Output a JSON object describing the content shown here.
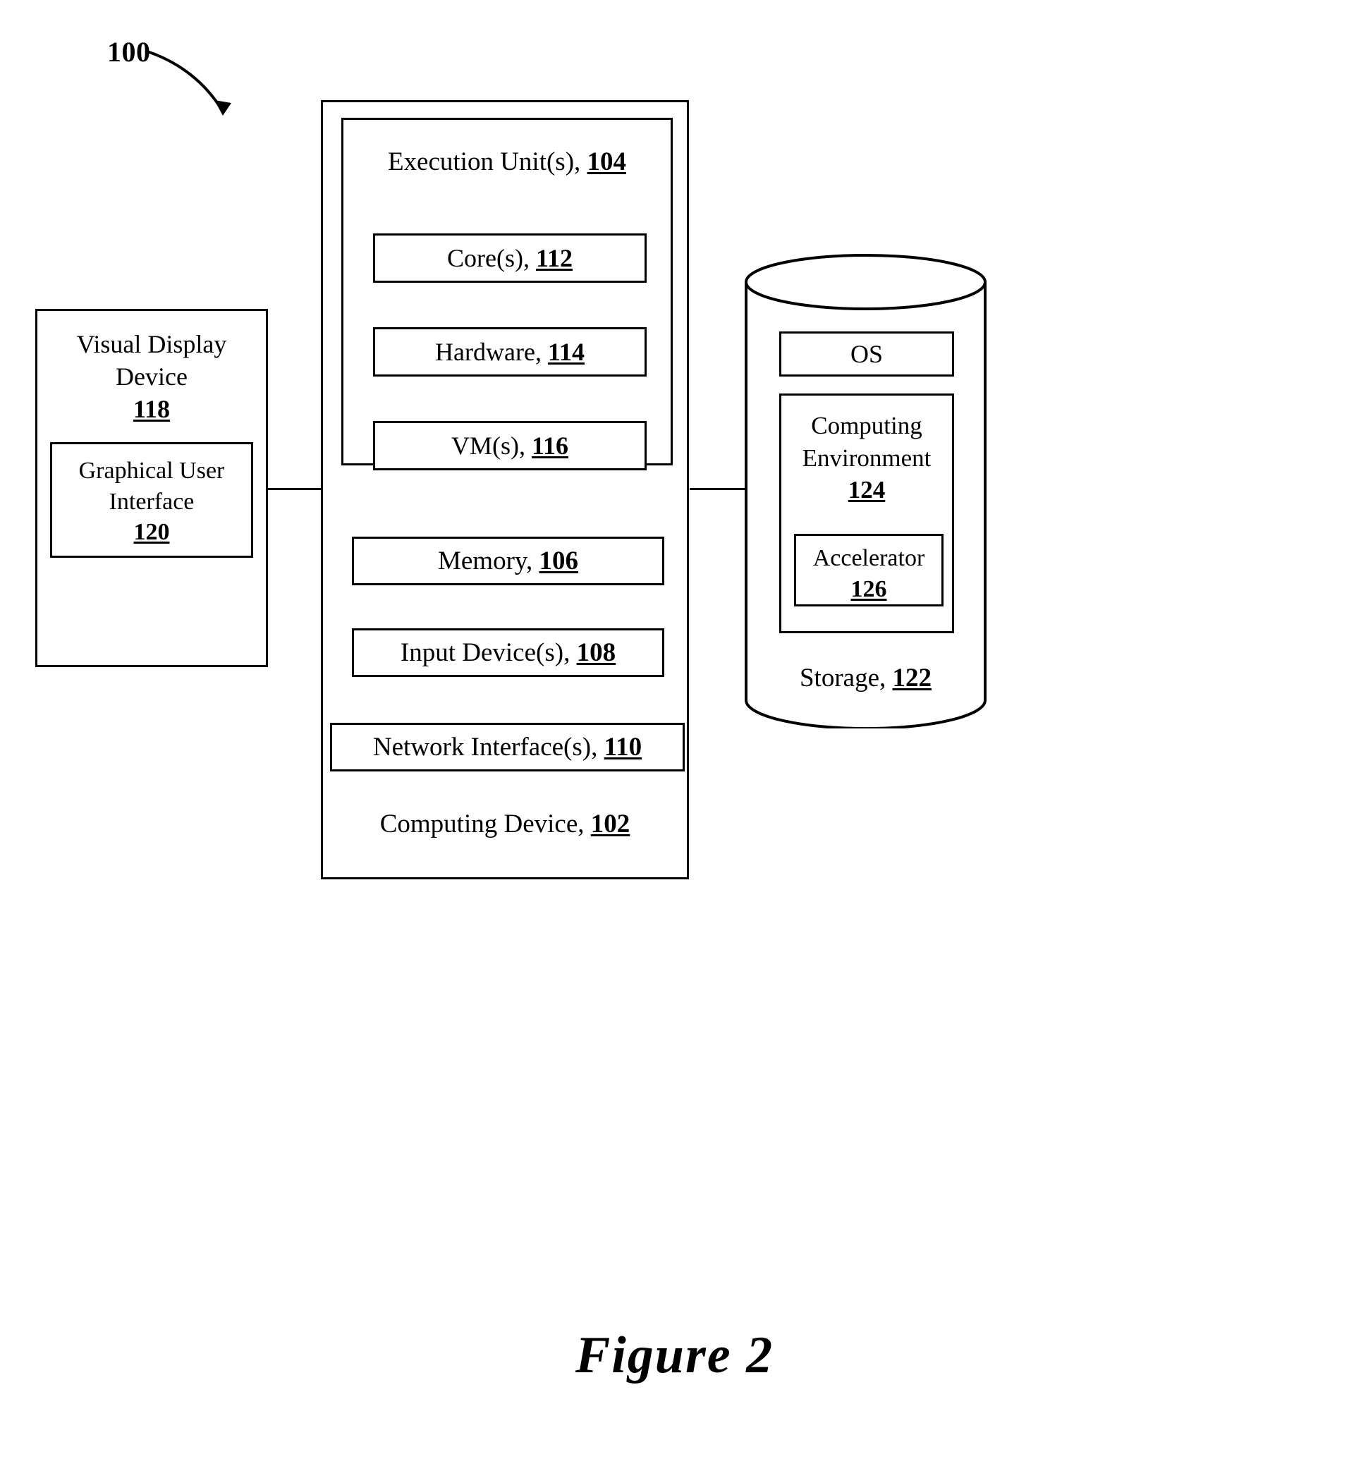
{
  "figure": {
    "reference_numeral": "100",
    "caption": "Figure 2"
  },
  "visual_display_device": {
    "title_line1": "Visual Display",
    "title_line2": "Device",
    "ref": "118",
    "gui": {
      "title_line1": "Graphical User",
      "title_line2": "Interface",
      "ref": "120"
    }
  },
  "computing_device": {
    "label": "Computing Device,",
    "ref": "102",
    "execution_unit": {
      "label": "Execution Unit(s),",
      "ref": "104",
      "components": [
        {
          "label": "Core(s),",
          "ref": "112"
        },
        {
          "label": "Hardware,",
          "ref": "114"
        },
        {
          "label": "VM(s),",
          "ref": "116"
        }
      ]
    },
    "memory": {
      "label": "Memory,",
      "ref": "106"
    },
    "input_devices": {
      "label": "Input Device(s),",
      "ref": "108"
    },
    "network_interfaces": {
      "label": "Network Interface(s),",
      "ref": "110"
    }
  },
  "storage": {
    "label": "Storage,",
    "ref": "122",
    "os": {
      "label": "OS"
    },
    "computing_environment": {
      "title_line1": "Computing",
      "title_line2": "Environment",
      "ref": "124",
      "accelerator": {
        "label": "Accelerator",
        "ref": "126"
      }
    }
  },
  "colors": {
    "stroke": "#000000",
    "background": "#ffffff"
  }
}
